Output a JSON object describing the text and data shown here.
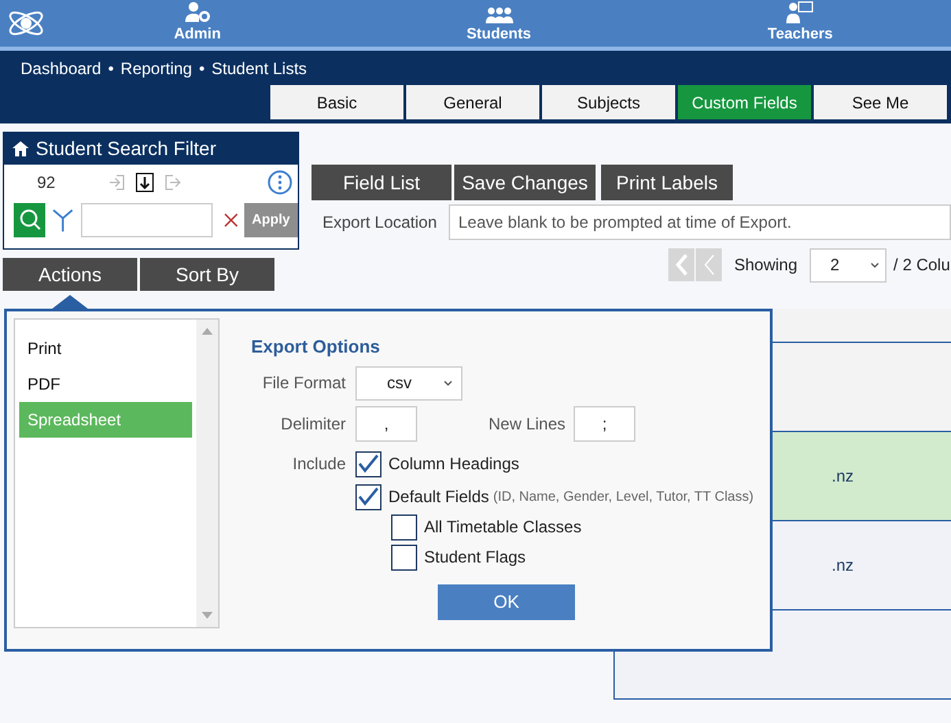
{
  "top_nav": [
    {
      "label": "Admin"
    },
    {
      "label": "Students"
    },
    {
      "label": "Teachers"
    }
  ],
  "breadcrumb": [
    "Dashboard",
    "•",
    "Reporting",
    "•",
    "Student Lists"
  ],
  "tabs": [
    {
      "label": "Basic",
      "selected": false
    },
    {
      "label": "General",
      "selected": false
    },
    {
      "label": "Subjects",
      "selected": false
    },
    {
      "label": "Custom Fields",
      "selected": true
    },
    {
      "label": "See Me",
      "selected": false
    }
  ],
  "filter": {
    "title": "Student Search Filter",
    "count": "92",
    "apply": {
      "label": "Apply",
      "disabled": true
    }
  },
  "toolbar": [
    "Field List",
    "Save Changes",
    "Print Labels"
  ],
  "export_location": {
    "label": "Export Location",
    "placeholder": "Leave blank to be prompted at time of Export."
  },
  "action_tabs": [
    {
      "label": "Actions",
      "expanded": true
    },
    {
      "label": "Sort By",
      "expanded": false
    }
  ],
  "pager": {
    "label": "Showing",
    "value": "2",
    "total": "/ 2 Colu"
  },
  "popup": {
    "list": [
      {
        "label": "Print",
        "selected": false
      },
      {
        "label": "PDF",
        "selected": false
      },
      {
        "label": "Spreadsheet",
        "selected": true
      }
    ],
    "title": "Export Options",
    "file_format": {
      "label": "File Format",
      "value": "csv"
    },
    "delimiter": {
      "label": "Delimiter",
      "value": ","
    },
    "new_lines": {
      "label": "New Lines",
      "value": ";"
    },
    "include_label": "Include",
    "options": [
      {
        "label": "Column Headings",
        "checked": true
      },
      {
        "label": "Default Fields",
        "note": "(ID, Name, Gender, Level, Tutor, TT Class)",
        "checked": true,
        "children": [
          {
            "label": "All Timetable Classes",
            "checked": false
          },
          {
            "label": "Student Flags",
            "checked": false
          }
        ]
      }
    ],
    "ok": "OK"
  },
  "table_rows": [
    {
      "text": "",
      "selected": false
    },
    {
      "text": "",
      "selected": false
    },
    {
      "text": ".nz",
      "selected": true
    },
    {
      "text": ".nz",
      "selected": false
    },
    {
      "text": "",
      "selected": false
    }
  ]
}
